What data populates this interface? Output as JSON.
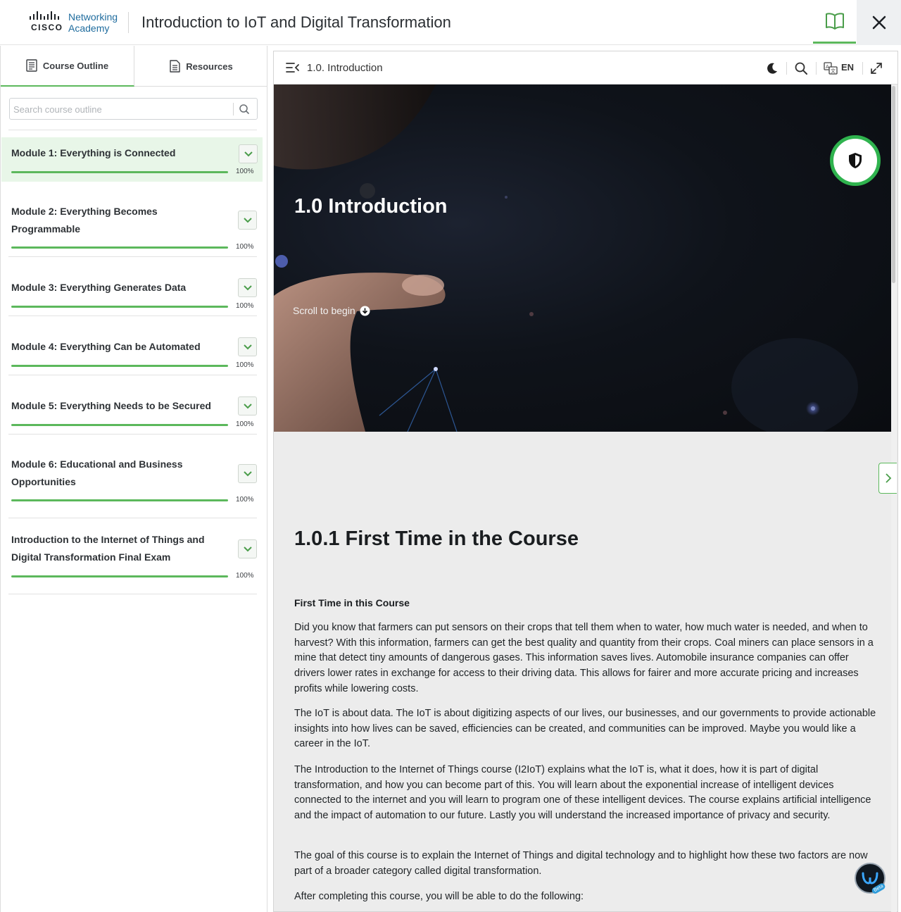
{
  "header": {
    "logo_cisco": "CISCO",
    "logo_line1": "Networking",
    "logo_line2": "Academy",
    "course_title": "Introduction to IoT and Digital Transformation"
  },
  "sidebar": {
    "tabs": [
      {
        "label": "Course Outline",
        "active": true
      },
      {
        "label": "Resources",
        "active": false
      }
    ],
    "search_placeholder": "Search course outline",
    "modules": [
      {
        "title": "Module 1: Everything is Connected",
        "progress": "100%",
        "active": true
      },
      {
        "title": "Module 2: Everything Becomes Programmable",
        "progress": "100%",
        "active": false
      },
      {
        "title": "Module 3: Everything Generates Data",
        "progress": "100%",
        "active": false
      },
      {
        "title": "Module 4: Everything Can be Automated",
        "progress": "100%",
        "active": false
      },
      {
        "title": "Module 5: Everything Needs to be Secured",
        "progress": "100%",
        "active": false
      },
      {
        "title": "Module 6: Educational and Business Opportunities",
        "progress": "100%",
        "active": false
      },
      {
        "title": "Introduction to the Internet of Things and Digital Transformation Final Exam",
        "progress": "100%",
        "active": false
      }
    ]
  },
  "toolbar": {
    "page_label": "1.0. Introduction",
    "language": "EN"
  },
  "hero": {
    "title": "1.0 Introduction",
    "scroll_hint": "Scroll to begin"
  },
  "content": {
    "section_title": "1.0.1 First Time in the Course",
    "subheading": "First Time in this Course",
    "paragraphs": [
      "Did you know that farmers can put sensors on their crops that tell them when to water, how much water is needed, and when to harvest? With this information, farmers can get the best quality and quantity from their crops. Coal miners can place sensors in a mine that detect tiny amounts of dangerous gases. This information saves lives. Automobile insurance companies can offer drivers lower rates in exchange for access to their driving data. This allows for fairer and more accurate pricing and increases profits while lowering costs.",
      "The IoT is about data. The IoT is about digitizing aspects of our lives, our businesses, and our governments to provide actionable insights into how lives can be saved, efficiencies can be created, and communities can be improved. Maybe you would like a career in the IoT.",
      "The Introduction to the Internet of Things course (I2IoT) explains what the IoT is, what it does, how it is part of digital transformation, and how you can become part of this. You will learn about the exponential increase of intelligent devices connected to the internet and you will learn to program one of these intelligent devices. The course explains artificial intelligence and the impact of automation to our future. Lastly you will understand the increased importance of privacy and security.",
      "The goal of this course is to explain the Internet of Things and digital technology and to highlight how these two factors are now part of a broader category called digital transformation.",
      "After completing this course, you will be able to do the following:"
    ]
  },
  "assistant": {
    "badge": "Beta"
  },
  "colors": {
    "accent_green": "#5cb85c",
    "cisco_blue": "#1f6c9e",
    "hero_bg": "#0f131a"
  }
}
